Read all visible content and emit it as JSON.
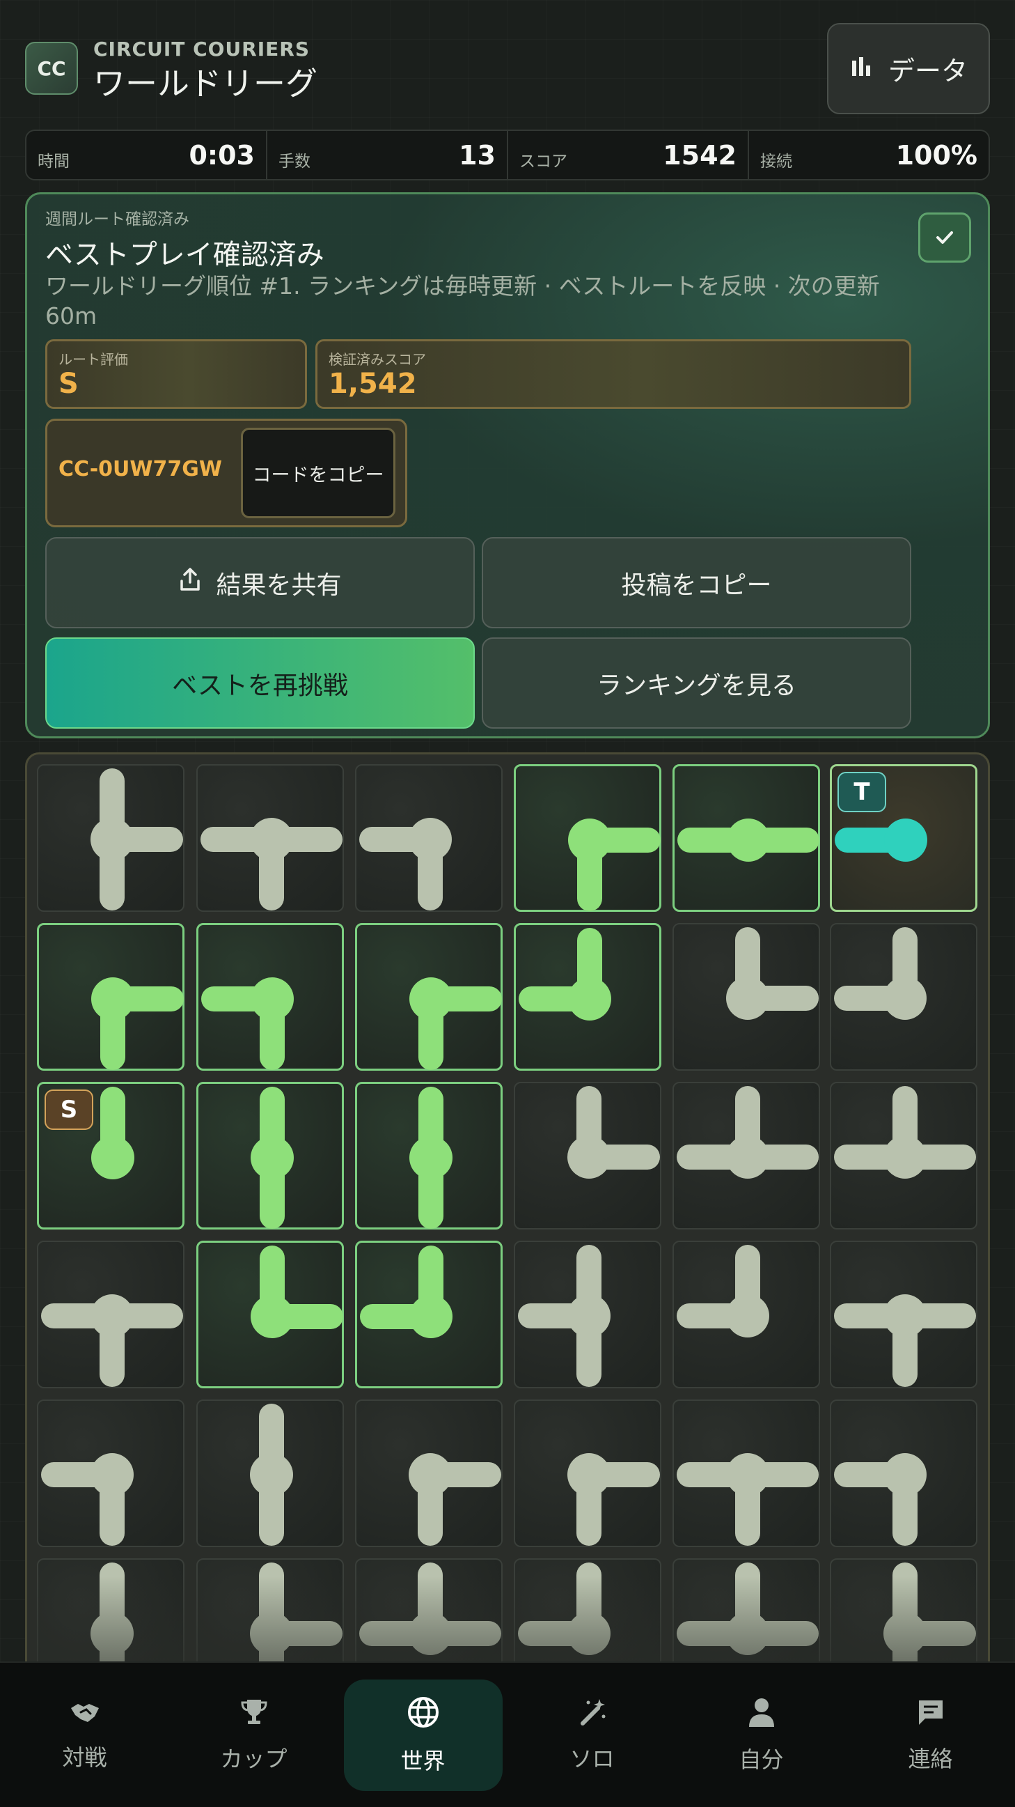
{
  "header": {
    "logo_text": "CC",
    "brand": "CIRCUIT COURIERS",
    "title": "ワールドリーグ",
    "data_button_label": "データ",
    "data_button_icon": "bar-chart-icon"
  },
  "stats": [
    {
      "label": "時間",
      "value": "0:03"
    },
    {
      "label": "手数",
      "value": "13"
    },
    {
      "label": "スコア",
      "value": "1542"
    },
    {
      "label": "接続",
      "value": "100%"
    }
  ],
  "verify": {
    "kicker": "週間ルート確認済み",
    "title": "ベストプレイ確認済み",
    "description": "ワールドリーグ順位 #1. ランキングは毎時更新 · ベストルートを反映 · 次の更新 60m",
    "rating_label": "ルート評価",
    "rating_value": "S",
    "score_label": "検証済みスコア",
    "score_value": "1,542",
    "code": "CC-0UW77GW",
    "copy_code_label": "コードをコピー",
    "share_label": "結果を共有",
    "copy_post_label": "投稿をコピー",
    "retry_label": "ベストを再挑戦",
    "ranking_label": "ランキングを見る"
  },
  "board": {
    "start_badge": "S",
    "target_badge": "T",
    "colors": {
      "idle": "#b9c2ae",
      "lit": "#8ee07a",
      "target": "#2fd1bd"
    },
    "rows": [
      [
        {
          "c": "NSE",
          "s": "idle"
        },
        {
          "c": "EWS",
          "s": "idle"
        },
        {
          "c": "WS",
          "s": "idle"
        },
        {
          "c": "ES",
          "s": "lit"
        },
        {
          "c": "EW",
          "s": "lit"
        },
        {
          "c": "W",
          "s": "target"
        }
      ],
      [
        {
          "c": "ES",
          "s": "lit"
        },
        {
          "c": "WS",
          "s": "lit"
        },
        {
          "c": "ES",
          "s": "lit"
        },
        {
          "c": "NW",
          "s": "lit"
        },
        {
          "c": "NE",
          "s": "idle"
        },
        {
          "c": "NW",
          "s": "idle"
        }
      ],
      [
        {
          "c": "N",
          "s": "lit"
        },
        {
          "c": "NS",
          "s": "lit"
        },
        {
          "c": "NS",
          "s": "lit"
        },
        {
          "c": "NE",
          "s": "idle"
        },
        {
          "c": "NEW",
          "s": "idle"
        },
        {
          "c": "NEW",
          "s": "idle"
        }
      ],
      [
        {
          "c": "EWS",
          "s": "idle"
        },
        {
          "c": "NE",
          "s": "lit"
        },
        {
          "c": "NW",
          "s": "lit"
        },
        {
          "c": "NSW",
          "s": "idle"
        },
        {
          "c": "NW",
          "s": "idle"
        },
        {
          "c": "EWS",
          "s": "idle"
        }
      ],
      [
        {
          "c": "WS",
          "s": "idle"
        },
        {
          "c": "NS",
          "s": "idle"
        },
        {
          "c": "ES",
          "s": "idle"
        },
        {
          "c": "ES",
          "s": "idle"
        },
        {
          "c": "EWS",
          "s": "idle"
        },
        {
          "c": "WS",
          "s": "idle"
        }
      ],
      [
        {
          "c": "NS",
          "s": "idle"
        },
        {
          "c": "NSE",
          "s": "idle"
        },
        {
          "c": "NEW",
          "s": "idle"
        },
        {
          "c": "NW",
          "s": "idle"
        },
        {
          "c": "NEW",
          "s": "idle"
        },
        {
          "c": "NSE",
          "s": "idle"
        }
      ]
    ]
  },
  "nav": [
    {
      "label": "対戦",
      "icon": "handshake-icon"
    },
    {
      "label": "カップ",
      "icon": "trophy-icon"
    },
    {
      "label": "世界",
      "icon": "globe-icon",
      "active": true
    },
    {
      "label": "ソロ",
      "icon": "magic-wand-icon"
    },
    {
      "label": "自分",
      "icon": "person-icon"
    },
    {
      "label": "連絡",
      "icon": "chat-icon"
    }
  ]
}
